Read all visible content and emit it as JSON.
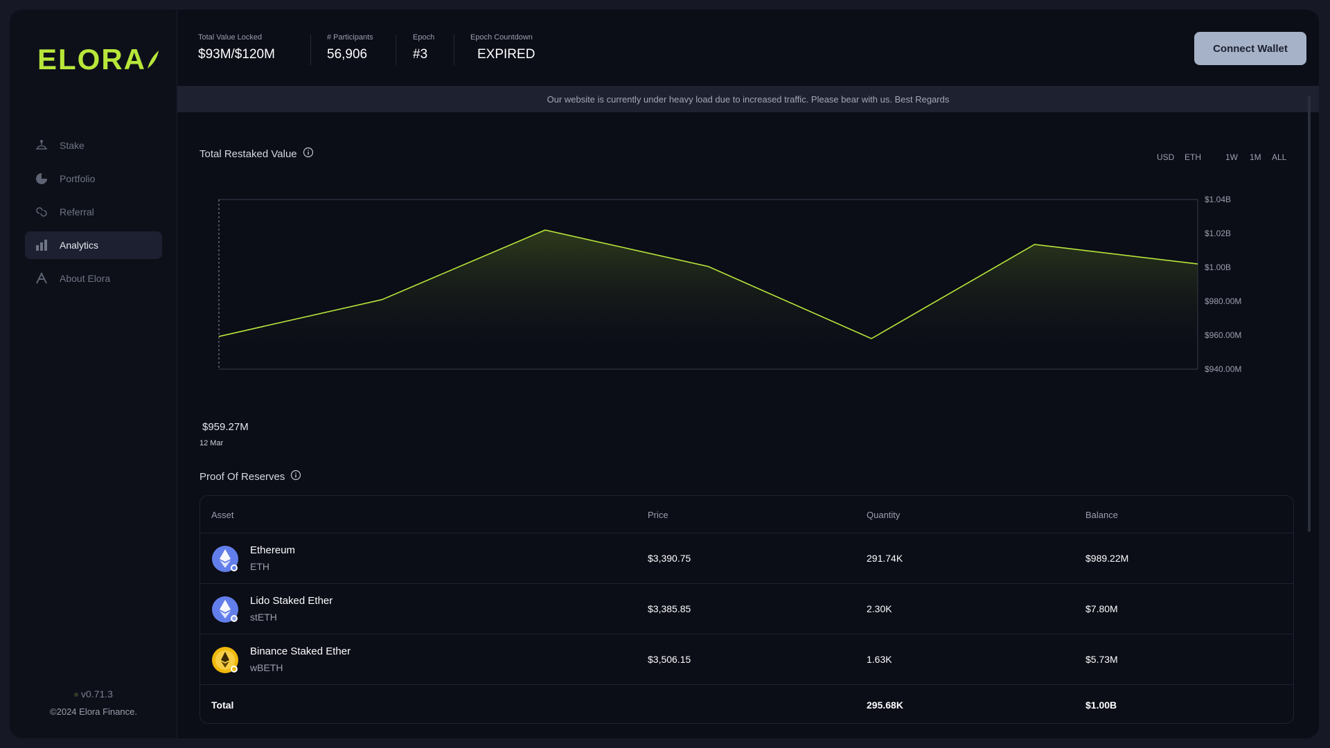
{
  "brand": {
    "name": "ELORA",
    "accent": "#b8e63a"
  },
  "nav": [
    {
      "label": "Stake",
      "icon": "stake-icon",
      "active": false
    },
    {
      "label": "Portfolio",
      "icon": "portfolio-icon",
      "active": false
    },
    {
      "label": "Referral",
      "icon": "referral-icon",
      "active": false
    },
    {
      "label": "Analytics",
      "icon": "analytics-icon",
      "active": true
    },
    {
      "label": "About Elora",
      "icon": "about-icon",
      "active": false
    }
  ],
  "footer": {
    "version": "v0.71.3",
    "copyright": "©2024 Elora Finance."
  },
  "header": {
    "stats": [
      {
        "label": "Total Value Locked",
        "value": "$93M/$120M"
      },
      {
        "label": "# Participants",
        "value": "56,906"
      },
      {
        "label": "Epoch",
        "value": "#3"
      },
      {
        "label": "Epoch Countdown",
        "value": "EXPIRED"
      }
    ],
    "connect_label": "Connect Wallet"
  },
  "banner": "Our website is currently under heavy load due to increased traffic. Please bear with us. Best Regards",
  "chart_section": {
    "title": "Total Restaked Value",
    "currency_toggles": [
      "USD",
      "ETH"
    ],
    "range_toggles": [
      "1W",
      "1M",
      "ALL"
    ],
    "hover_value": "$959.27M",
    "hover_date": "12 Mar"
  },
  "chart_data": {
    "type": "area",
    "title": "Total Restaked Value",
    "y_unit": "USD",
    "ylim": [
      940,
      1040
    ],
    "y_ticks": [
      "$1.04B",
      "$1.02B",
      "$1.00B",
      "$980.00M",
      "$960.00M",
      "$940.00M"
    ],
    "y_tick_values": [
      1040,
      1020,
      1000,
      980,
      960,
      940
    ],
    "series": [
      {
        "values": [
          959.27,
          981,
          1022,
          1000.5,
          958,
          1013.5,
          1002
        ]
      }
    ],
    "line_color": "#b8e63a",
    "grid": false
  },
  "reserves": {
    "title": "Proof Of Reserves",
    "columns": [
      "Asset",
      "Price",
      "Quantity",
      "Balance"
    ],
    "rows": [
      {
        "name": "Ethereum",
        "symbol": "ETH",
        "icon": "ethereum-icon",
        "price": "$3,390.75",
        "quantity": "291.74K",
        "balance": "$989.22M",
        "icon_color": "#627eea"
      },
      {
        "name": "Lido Staked Ether",
        "symbol": "stETH",
        "icon": "steth-icon",
        "price": "$3,385.85",
        "quantity": "2.30K",
        "balance": "$7.80M",
        "icon_color": "#627eea"
      },
      {
        "name": "Binance Staked Ether",
        "symbol": "wBETH",
        "icon": "wbeth-icon",
        "price": "$3,506.15",
        "quantity": "1.63K",
        "balance": "$5.73M",
        "icon_color": "#f0b90b"
      }
    ],
    "total": {
      "label": "Total",
      "quantity": "295.68K",
      "balance": "$1.00B"
    }
  }
}
